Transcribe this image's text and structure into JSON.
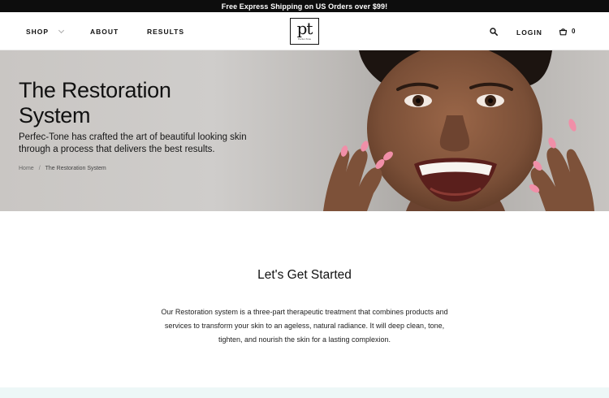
{
  "announcement": {
    "text": "Free Express Shipping on US Orders over $99!"
  },
  "nav": {
    "shop_label": "SHOP",
    "about_label": "ABOUT",
    "results_label": "RESULTS",
    "login_label": "LOGIN",
    "cart_count": "0"
  },
  "logo": {
    "monogram": "pt",
    "wordmark": "Perfec-Tone"
  },
  "hero": {
    "title": "The Restoration System",
    "subtitle": "Perfec-Tone has crafted the art of beautiful looking skin through a process that delivers the best results.",
    "breadcrumb_home": "Home",
    "breadcrumb_separator": "/",
    "breadcrumb_current": "The Restoration System"
  },
  "intro": {
    "title": "Let's Get Started",
    "body": "Our Restoration system is a three-part therapeutic treatment that combines products and services to transform your skin to an ageless, natural radiance. It will deep clean, tone, tighten, and nourish the skin for a lasting complexion."
  },
  "icons": {
    "search": "search-icon",
    "cart": "cart-icon",
    "dropdown": "chevron-down-icon"
  },
  "colors": {
    "announcement_bg": "#0d0d0d",
    "hero_bg": "#c9c6c3",
    "nail_polish": "#f08fa8",
    "skin": "#7a4f37",
    "next_band": "#edf7f7"
  }
}
